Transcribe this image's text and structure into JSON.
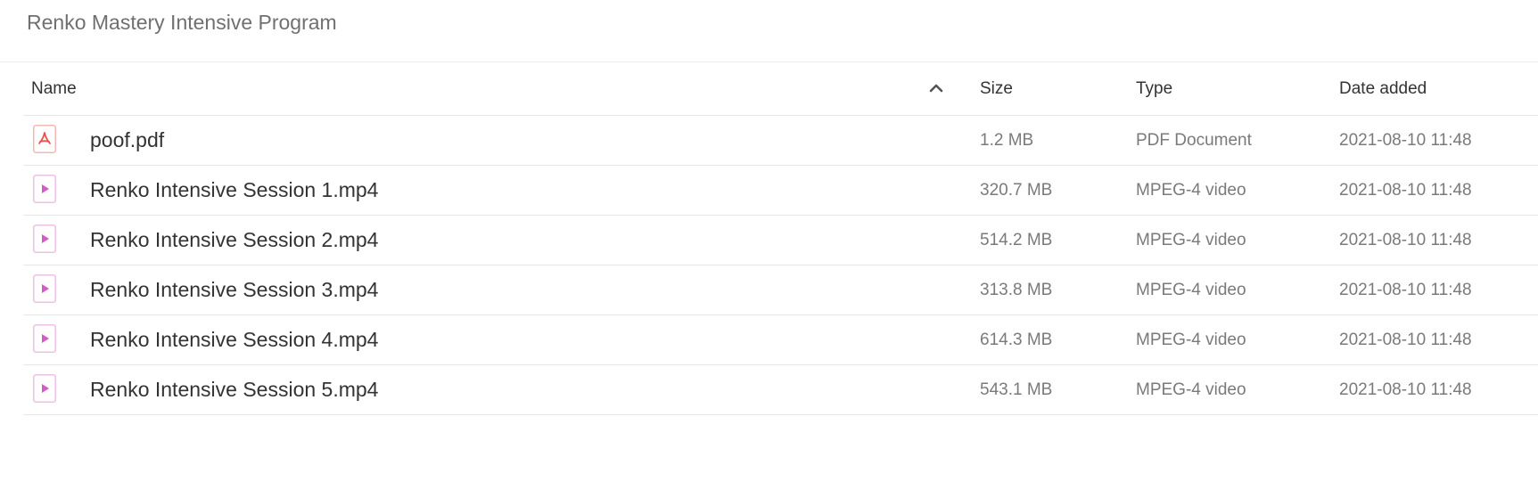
{
  "folder": {
    "title": "Renko Mastery Intensive Program"
  },
  "table": {
    "columns": {
      "name": "Name",
      "size": "Size",
      "type": "Type",
      "date_added": "Date added"
    },
    "sort": {
      "column": "name",
      "direction": "ascending",
      "icon": "chevron-up-icon"
    },
    "rows": [
      {
        "name": "poof.pdf",
        "size": "1.2 MB",
        "type": "PDF Document",
        "date_added": "2021-08-10 11:48",
        "icon": "pdf-file-icon"
      },
      {
        "name": "Renko Intensive Session 1.mp4",
        "size": "320.7 MB",
        "type": "MPEG-4 video",
        "date_added": "2021-08-10 11:48",
        "icon": "video-file-icon"
      },
      {
        "name": "Renko Intensive Session 2.mp4",
        "size": "514.2 MB",
        "type": "MPEG-4 video",
        "date_added": "2021-08-10 11:48",
        "icon": "video-file-icon"
      },
      {
        "name": "Renko Intensive Session 3.mp4",
        "size": "313.8 MB",
        "type": "MPEG-4 video",
        "date_added": "2021-08-10 11:48",
        "icon": "video-file-icon"
      },
      {
        "name": "Renko Intensive Session 4.mp4",
        "size": "614.3 MB",
        "type": "MPEG-4 video",
        "date_added": "2021-08-10 11:48",
        "icon": "video-file-icon"
      },
      {
        "name": "Renko Intensive Session 5.mp4",
        "size": "543.1 MB",
        "type": "MPEG-4 video",
        "date_added": "2021-08-10 11:48",
        "icon": "video-file-icon"
      }
    ]
  },
  "colors": {
    "pdf_icon": "#e8534f",
    "video_icon": "#d45cc4"
  }
}
